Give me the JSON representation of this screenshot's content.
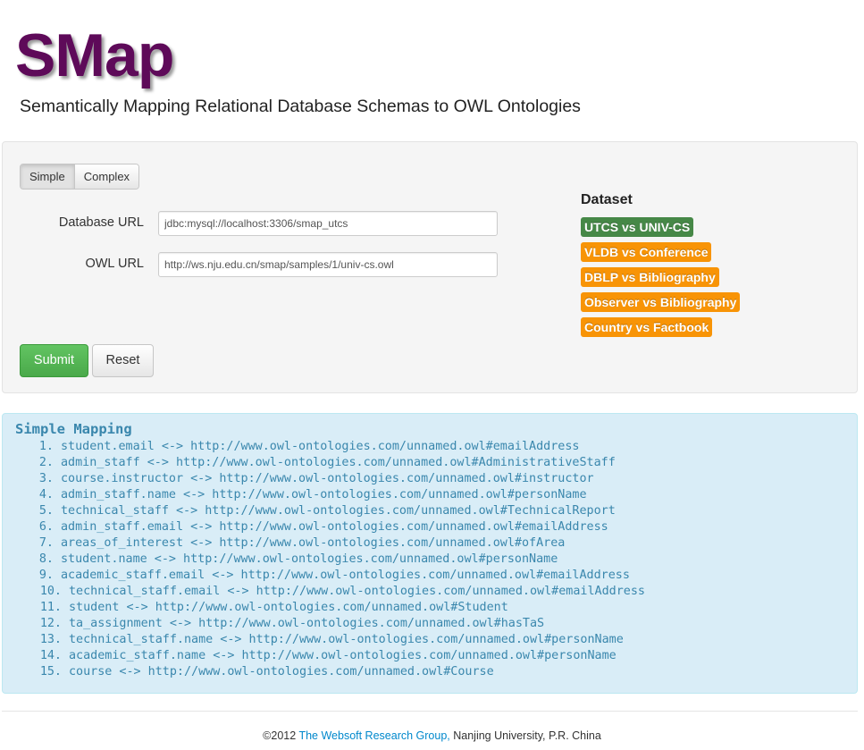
{
  "header": {
    "logo": "SMap",
    "subtitle": "Semantically Mapping Relational Database Schemas to OWL Ontologies"
  },
  "form": {
    "mode_tabs": [
      {
        "label": "Simple",
        "active": true
      },
      {
        "label": "Complex",
        "active": false
      }
    ],
    "database_url_label": "Database URL",
    "database_url_value": "jdbc:mysql://localhost:3306/smap_utcs",
    "owl_url_label": "OWL URL",
    "owl_url_value": "http://ws.nju.edu.cn/smap/samples/1/univ-cs.owl",
    "submit_label": "Submit",
    "reset_label": "Reset"
  },
  "dataset": {
    "title": "Dataset",
    "items": [
      {
        "label": "UTCS vs UNIV-CS",
        "color": "#468847"
      },
      {
        "label": "VLDB vs Conference",
        "color": "#f89406"
      },
      {
        "label": "DBLP vs Bibliography",
        "color": "#f89406"
      },
      {
        "label": "Observer vs Bibliography",
        "color": "#f89406"
      },
      {
        "label": "Country vs Factbook",
        "color": "#f89406"
      }
    ]
  },
  "mapping": {
    "title": "Simple Mapping",
    "items": [
      {
        "num": "1.",
        "text": "student.email <-> http://www.owl-ontologies.com/unnamed.owl#emailAddress"
      },
      {
        "num": "2.",
        "text": "admin_staff <-> http://www.owl-ontologies.com/unnamed.owl#AdministrativeStaff"
      },
      {
        "num": "3.",
        "text": "course.instructor <-> http://www.owl-ontologies.com/unnamed.owl#instructor"
      },
      {
        "num": "4.",
        "text": "admin_staff.name <-> http://www.owl-ontologies.com/unnamed.owl#personName"
      },
      {
        "num": "5.",
        "text": "technical_staff <-> http://www.owl-ontologies.com/unnamed.owl#TechnicalReport"
      },
      {
        "num": "6.",
        "text": "admin_staff.email <-> http://www.owl-ontologies.com/unnamed.owl#emailAddress"
      },
      {
        "num": "7.",
        "text": "areas_of_interest <-> http://www.owl-ontologies.com/unnamed.owl#ofArea"
      },
      {
        "num": "8.",
        "text": "student.name <-> http://www.owl-ontologies.com/unnamed.owl#personName"
      },
      {
        "num": "9.",
        "text": "academic_staff.email <-> http://www.owl-ontologies.com/unnamed.owl#emailAddress"
      },
      {
        "num": "10.",
        "text": "technical_staff.email <-> http://www.owl-ontologies.com/unnamed.owl#emailAddress"
      },
      {
        "num": "11.",
        "text": "student <-> http://www.owl-ontologies.com/unnamed.owl#Student"
      },
      {
        "num": "12.",
        "text": "ta_assignment <-> http://www.owl-ontologies.com/unnamed.owl#hasTaS"
      },
      {
        "num": "13.",
        "text": "technical_staff.name <-> http://www.owl-ontologies.com/unnamed.owl#personName"
      },
      {
        "num": "14.",
        "text": "academic_staff.name <-> http://www.owl-ontologies.com/unnamed.owl#personName"
      },
      {
        "num": "15.",
        "text": "course <-> http://www.owl-ontologies.com/unnamed.owl#Course"
      }
    ]
  },
  "footer": {
    "copyright": "©2012",
    "link_text": "The Websoft Research Group,",
    "rest": "Nanjing University, P.R. China"
  }
}
